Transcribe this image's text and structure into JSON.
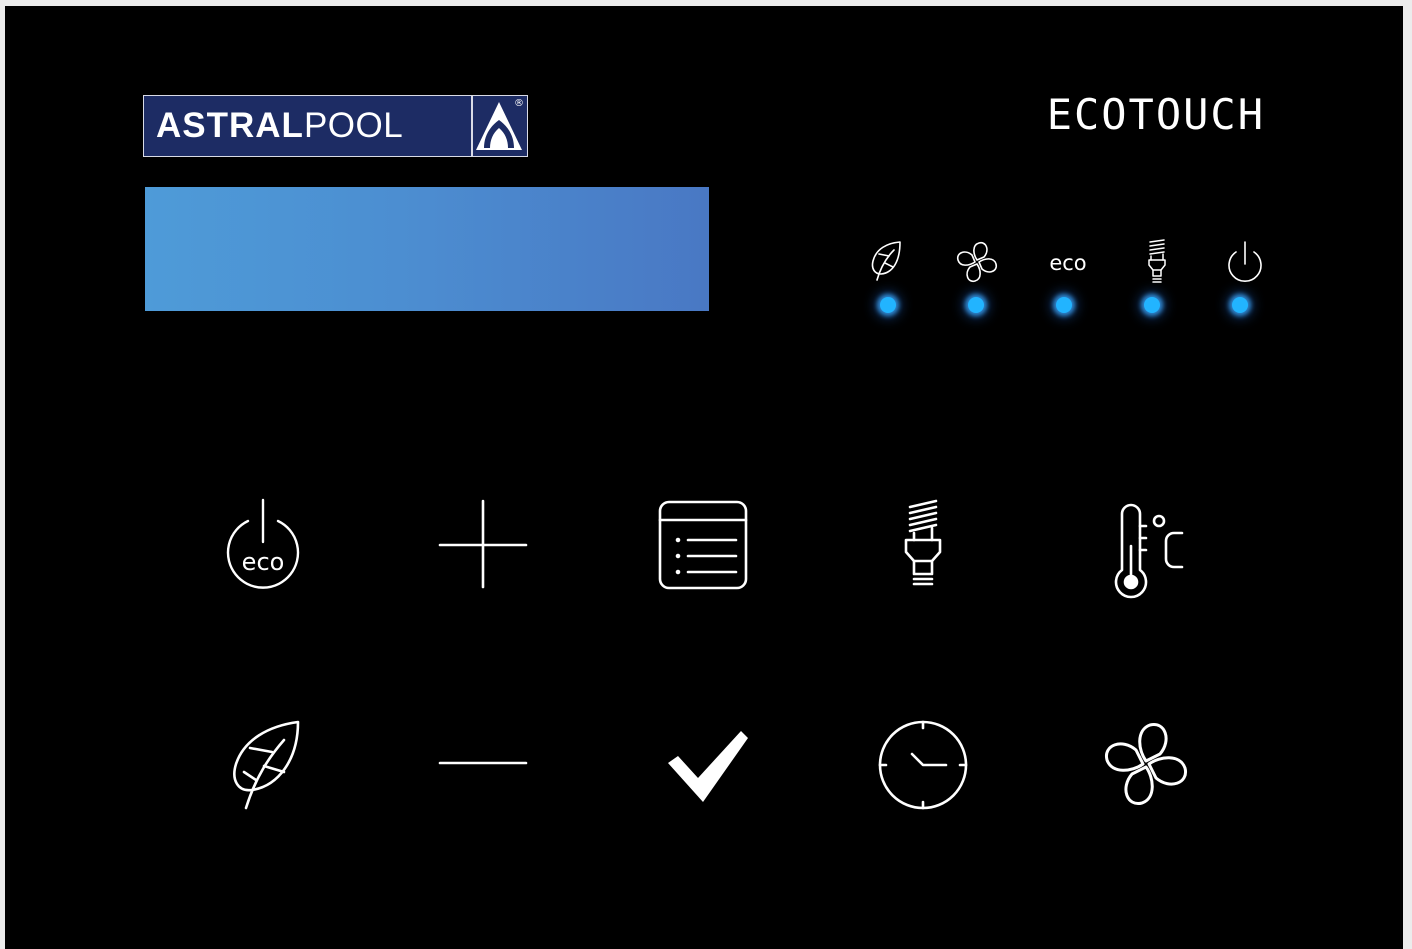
{
  "logo": {
    "brand_bold": "ASTRAL",
    "brand_light": "POOL",
    "registered": "®"
  },
  "header": {
    "product_name": "ECOTOUCH"
  },
  "display": {
    "text": "",
    "color_start": "#4e9bd8",
    "color_end": "#4978c4"
  },
  "indicators": [
    {
      "icon": "leaf-icon",
      "label": "",
      "led": "on"
    },
    {
      "icon": "fan-icon",
      "label": "",
      "led": "on"
    },
    {
      "icon": "eco-text",
      "label": "eco",
      "led": "on"
    },
    {
      "icon": "bulb-icon",
      "label": "",
      "led": "on"
    },
    {
      "icon": "power-icon",
      "label": "",
      "led": "on"
    }
  ],
  "buttons": {
    "row1": [
      {
        "icon": "power-eco-icon",
        "label": "eco"
      },
      {
        "icon": "plus-icon",
        "label": ""
      },
      {
        "icon": "menu-list-icon",
        "label": ""
      },
      {
        "icon": "bulb-icon",
        "label": ""
      },
      {
        "icon": "thermometer-celsius-icon",
        "label": ""
      }
    ],
    "row2": [
      {
        "icon": "leaf-icon",
        "label": ""
      },
      {
        "icon": "minus-icon",
        "label": ""
      },
      {
        "icon": "checkmark-icon",
        "label": ""
      },
      {
        "icon": "clock-icon",
        "label": ""
      },
      {
        "icon": "fan-icon",
        "label": ""
      }
    ]
  },
  "colors": {
    "panel": "#000000",
    "led": "#22b4ff",
    "logo_bg": "#1d2c64",
    "icon": "#ffffff"
  }
}
